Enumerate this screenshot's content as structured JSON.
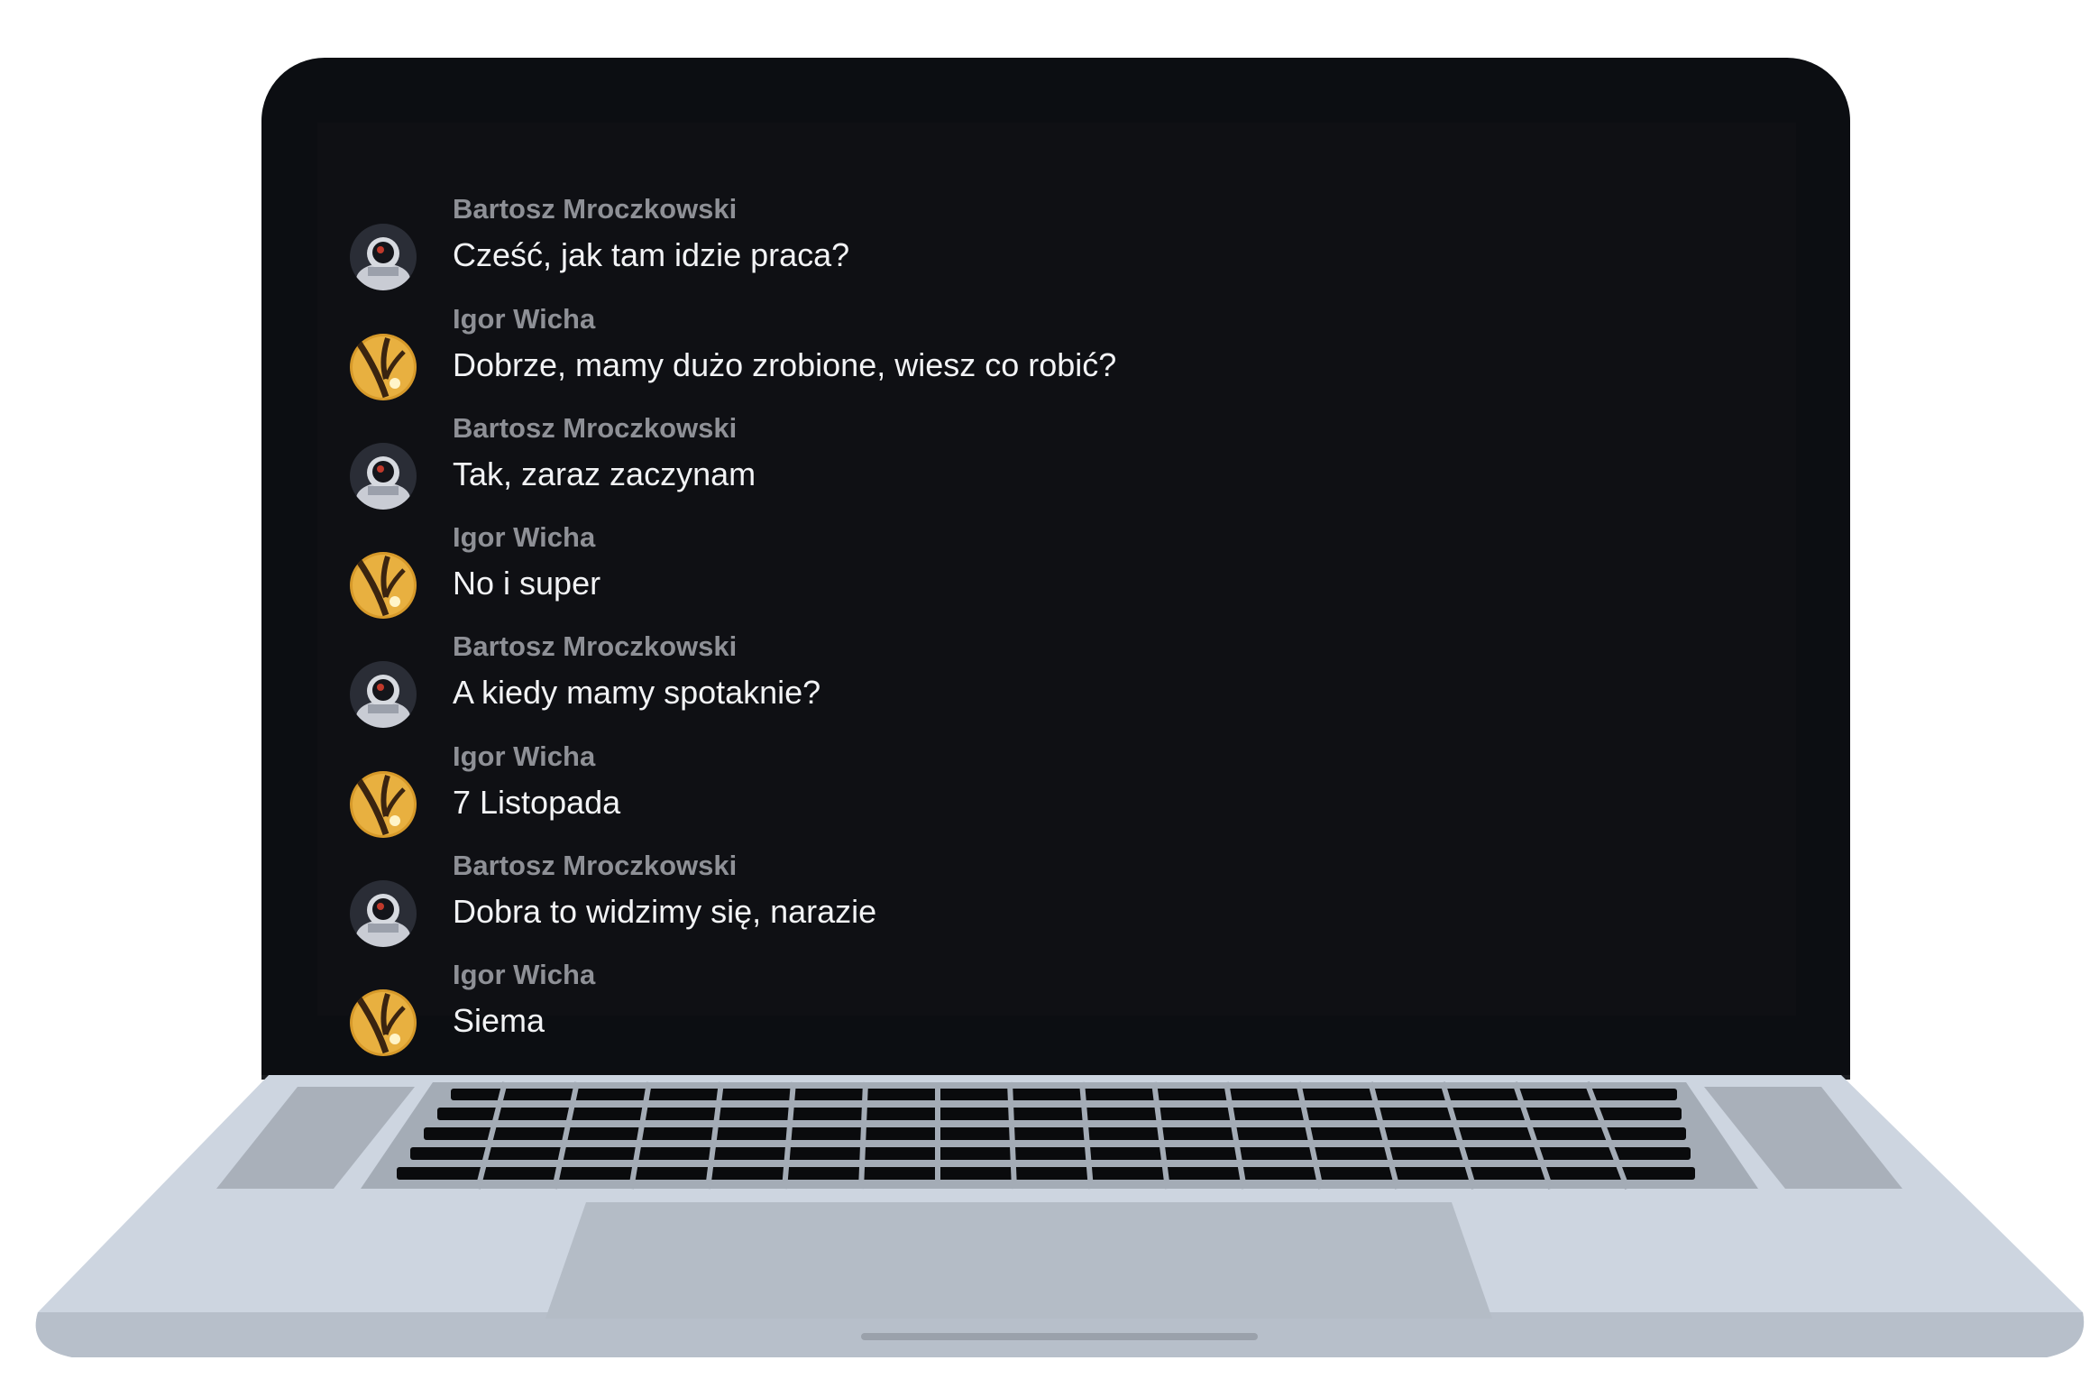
{
  "chat": {
    "messages": [
      {
        "author": "Bartosz Mroczkowski",
        "text": "Cześć, jak tam idzie praca?",
        "avatar": "astronaut-icon"
      },
      {
        "author": "Igor Wicha",
        "text": "Dobrze, mamy dużo zrobione, wiesz co robić?",
        "avatar": "gold-tree-icon"
      },
      {
        "author": "Bartosz Mroczkowski",
        "text": "Tak, zaraz zaczynam",
        "avatar": "astronaut-icon"
      },
      {
        "author": "Igor Wicha",
        "text": "No i super",
        "avatar": "gold-tree-icon"
      },
      {
        "author": "Bartosz Mroczkowski",
        "text": "A kiedy mamy spotaknie?",
        "avatar": "astronaut-icon"
      },
      {
        "author": "Igor Wicha",
        "text": "7 Listopada",
        "avatar": "gold-tree-icon"
      },
      {
        "author": "Bartosz Mroczkowski",
        "text": "Dobra to widzimy się, narazie",
        "avatar": "astronaut-icon"
      },
      {
        "author": "Igor Wicha",
        "text": "Siema",
        "avatar": "gold-tree-icon"
      }
    ]
  },
  "colors": {
    "bezel": "#0c0e12",
    "screen_bg": "#0f1014",
    "author_text": "#8e9096",
    "message_text": "#f2f3f5",
    "laptop_body": "#cfd6e0"
  }
}
